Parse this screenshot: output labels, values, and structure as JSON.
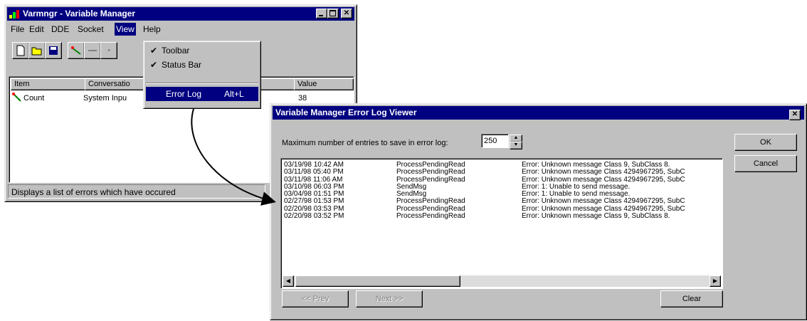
{
  "main_window": {
    "title": "Varmngr - Variable Manager",
    "menu": [
      "File",
      "Edit",
      "DDE",
      "Socket",
      "View",
      "Help"
    ],
    "active_menu_index": 4,
    "list": {
      "columns": [
        "Item",
        "Conversatio",
        "Value"
      ],
      "rows": [
        {
          "item": "Count",
          "conversation": "System Inpu",
          "value": "38"
        }
      ]
    },
    "status_text": "Displays a list of errors which have occured"
  },
  "view_menu": {
    "items": [
      {
        "label": "Toolbar",
        "checked": true,
        "accel": ""
      },
      {
        "label": "Status Bar",
        "checked": true,
        "accel": ""
      },
      {
        "label": "Error Log",
        "checked": false,
        "accel": "Alt+L"
      }
    ],
    "selected_index": 2
  },
  "error_dialog": {
    "title": "Variable Manager Error Log Viewer",
    "max_label": "Maximum number of entries to save in error log:",
    "max_value": "250",
    "entries": [
      [
        "03/19/98 10:42 AM",
        "ProcessPendingRead",
        "Error: Unknown message Class 9, SubClass 8."
      ],
      [
        "03/11/98 05:40 PM",
        "ProcessPendingRead",
        "Error: Unknown message Class 4294967295, SubC"
      ],
      [
        "03/11/98 11:06 AM",
        "ProcessPendingRead",
        "Error: Unknown message Class 4294967295, SubC"
      ],
      [
        "03/10/98 06:03 PM",
        "SendMsg",
        "Error: 1: Unable to send message."
      ],
      [
        "03/04/98 01:51 PM",
        "SendMsg",
        "Error: 1: Unable to send message."
      ],
      [
        "02/27/98 01:53 PM",
        "ProcessPendingRead",
        "Error: Unknown message Class 4294967295, SubC"
      ],
      [
        "02/20/98 03:53 PM",
        "ProcessPendingRead",
        "Error: Unknown message Class 4294967295, SubC"
      ],
      [
        "02/20/98 03:52 PM",
        "ProcessPendingRead",
        "Error: Unknown message Class 9, SubClass 8."
      ]
    ],
    "buttons": {
      "ok": "OK",
      "cancel": "Cancel",
      "prev": "<< Prev",
      "next": "Next >>",
      "clear": "Clear"
    }
  },
  "colors": {
    "titlebar": "#000080",
    "face": "#c0c0c0",
    "highlight": "#000080"
  }
}
